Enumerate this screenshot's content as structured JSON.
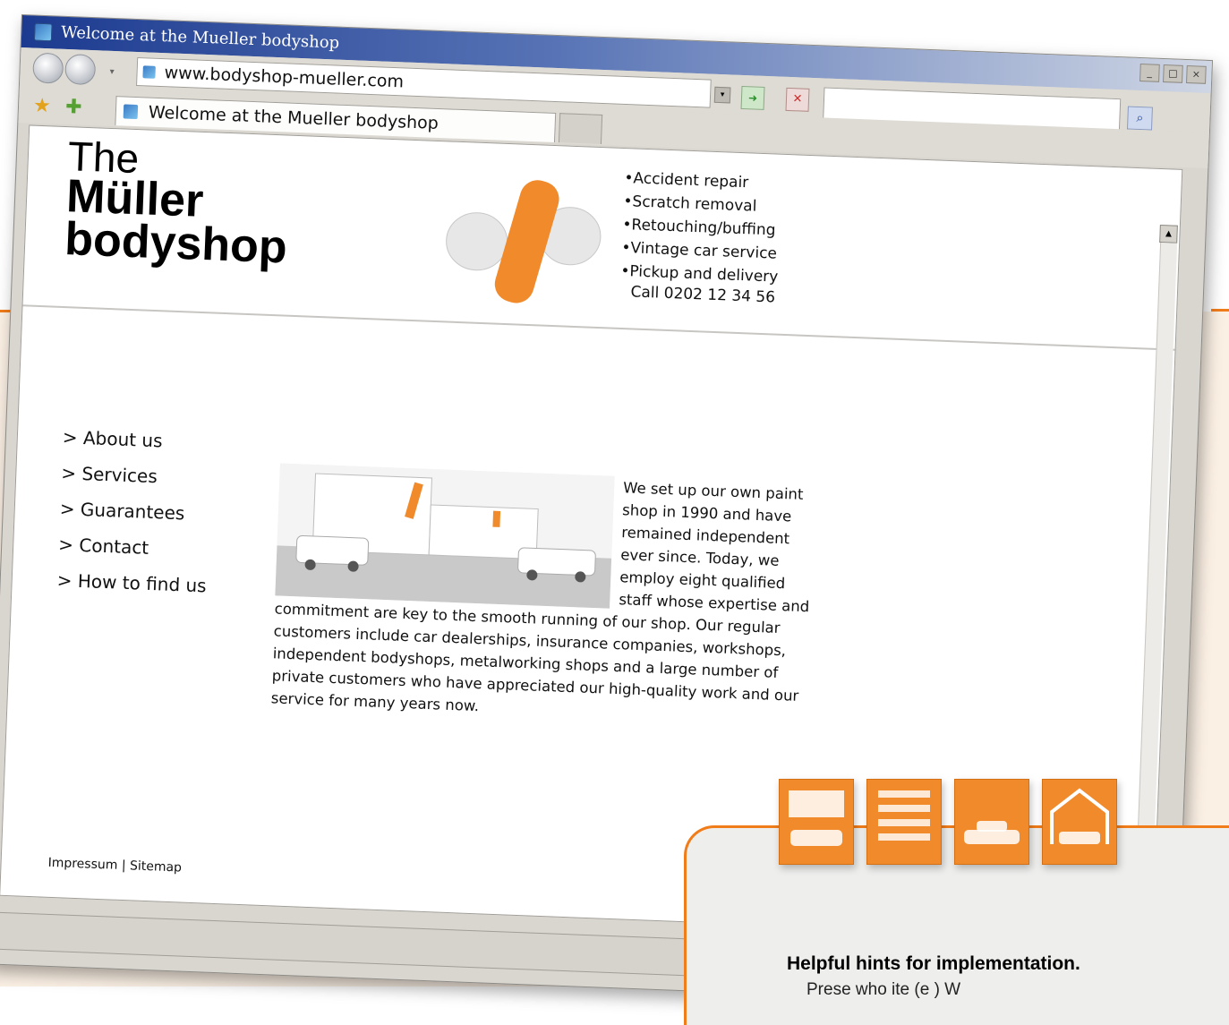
{
  "window": {
    "title": "Welcome at the Mueller bodyshop",
    "controls": [
      "_",
      "□",
      "×"
    ]
  },
  "toolbar": {
    "back_icon": "back-arrow-icon",
    "forward_icon": "forward-arrow-icon",
    "address": "www.bodyshop-mueller.com",
    "dropdown_glyph": "▾",
    "go_glyph": "➜",
    "stop_glyph": "✕",
    "search_placeholder": "",
    "search_glyph": "⌕"
  },
  "tabs": {
    "favorites_icon": "star-icon",
    "add_favorite_icon": "add-favorite-icon",
    "active_tab_label": "Welcome at the Mueller bodyshop"
  },
  "page": {
    "logo": {
      "line1": "The",
      "line2": "Müller",
      "line3": "bodyshop"
    },
    "services": [
      "Accident repair",
      "Scratch removal",
      "Retouching/buffing",
      "Vintage car service",
      "Pickup and delivery"
    ],
    "phone": "Call 0202 12 34 56",
    "nav": [
      "> About us",
      "> Services",
      "> Guarantees",
      "> Contact",
      "> How to find us"
    ],
    "intro": "We set up our own paint shop in 1990 and have remained independent ever since. Today, we employ eight qualified staff whose expertise and commitment are key to the smooth running of our shop. Our regular customers include car dealerships, insurance companies, workshops, independent bodyshops, metalworking shops and a large number of private customers who have appreciated our high-quality work and our service for many years now.",
    "footer": {
      "impressum": "Impressum",
      "separator": "|",
      "sitemap": "Sitemap"
    }
  },
  "hints": {
    "title": "Helpful hints for implementation.",
    "text": "Prese                       who           ite (e  ) W"
  },
  "colors": {
    "accent_orange": "#f07c1a",
    "titlebar_blue": "#1c3a8f",
    "panel_beige": "#fbf0e4"
  }
}
